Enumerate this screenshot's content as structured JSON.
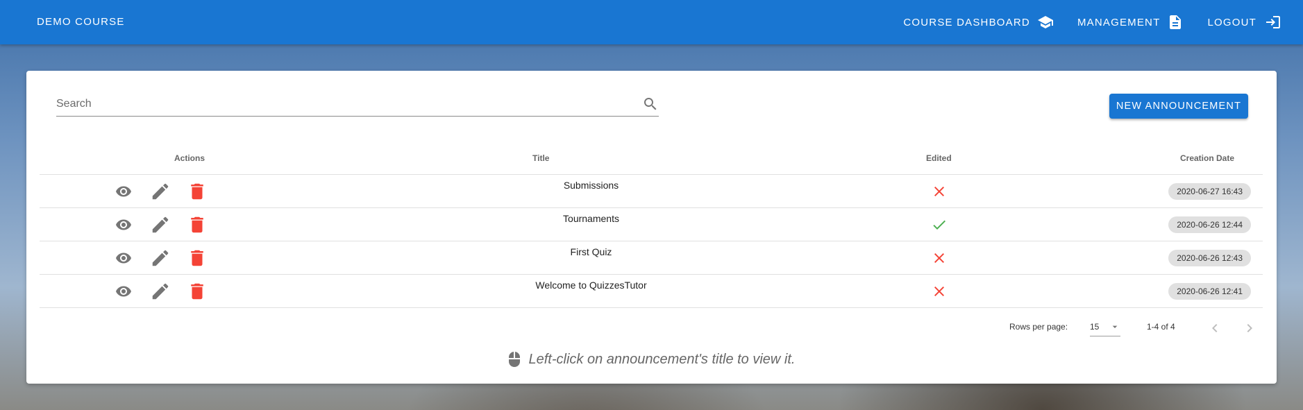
{
  "appbar": {
    "brand": "Demo Course",
    "nav": [
      {
        "label": "Course Dashboard",
        "icon": "school-icon"
      },
      {
        "label": "Management",
        "icon": "file-document-icon"
      },
      {
        "label": "Logout",
        "icon": "logout-icon"
      }
    ]
  },
  "toolbar": {
    "search_placeholder": "Search",
    "new_button": "New Announcement"
  },
  "table": {
    "headers": {
      "actions": "Actions",
      "title": "Title",
      "edited": "Edited",
      "date": "Creation Date"
    },
    "rows": [
      {
        "title": "Submissions",
        "edited": false,
        "date": "2020-06-27 16:43"
      },
      {
        "title": "Tournaments",
        "edited": true,
        "date": "2020-06-26 12:44"
      },
      {
        "title": "First Quiz",
        "edited": false,
        "date": "2020-06-26 12:43"
      },
      {
        "title": "Welcome to QuizzesTutor",
        "edited": false,
        "date": "2020-06-26 12:41"
      }
    ]
  },
  "footer": {
    "rows_per_page_label": "Rows per page:",
    "rows_per_page_value": "15",
    "range": "1-4 of 4"
  },
  "hint": "Left-click on announcement's title to view it.",
  "colors": {
    "primary": "#1976d2",
    "delete": "#f44336",
    "check": "#4caf50",
    "icon_gray": "#757575"
  }
}
